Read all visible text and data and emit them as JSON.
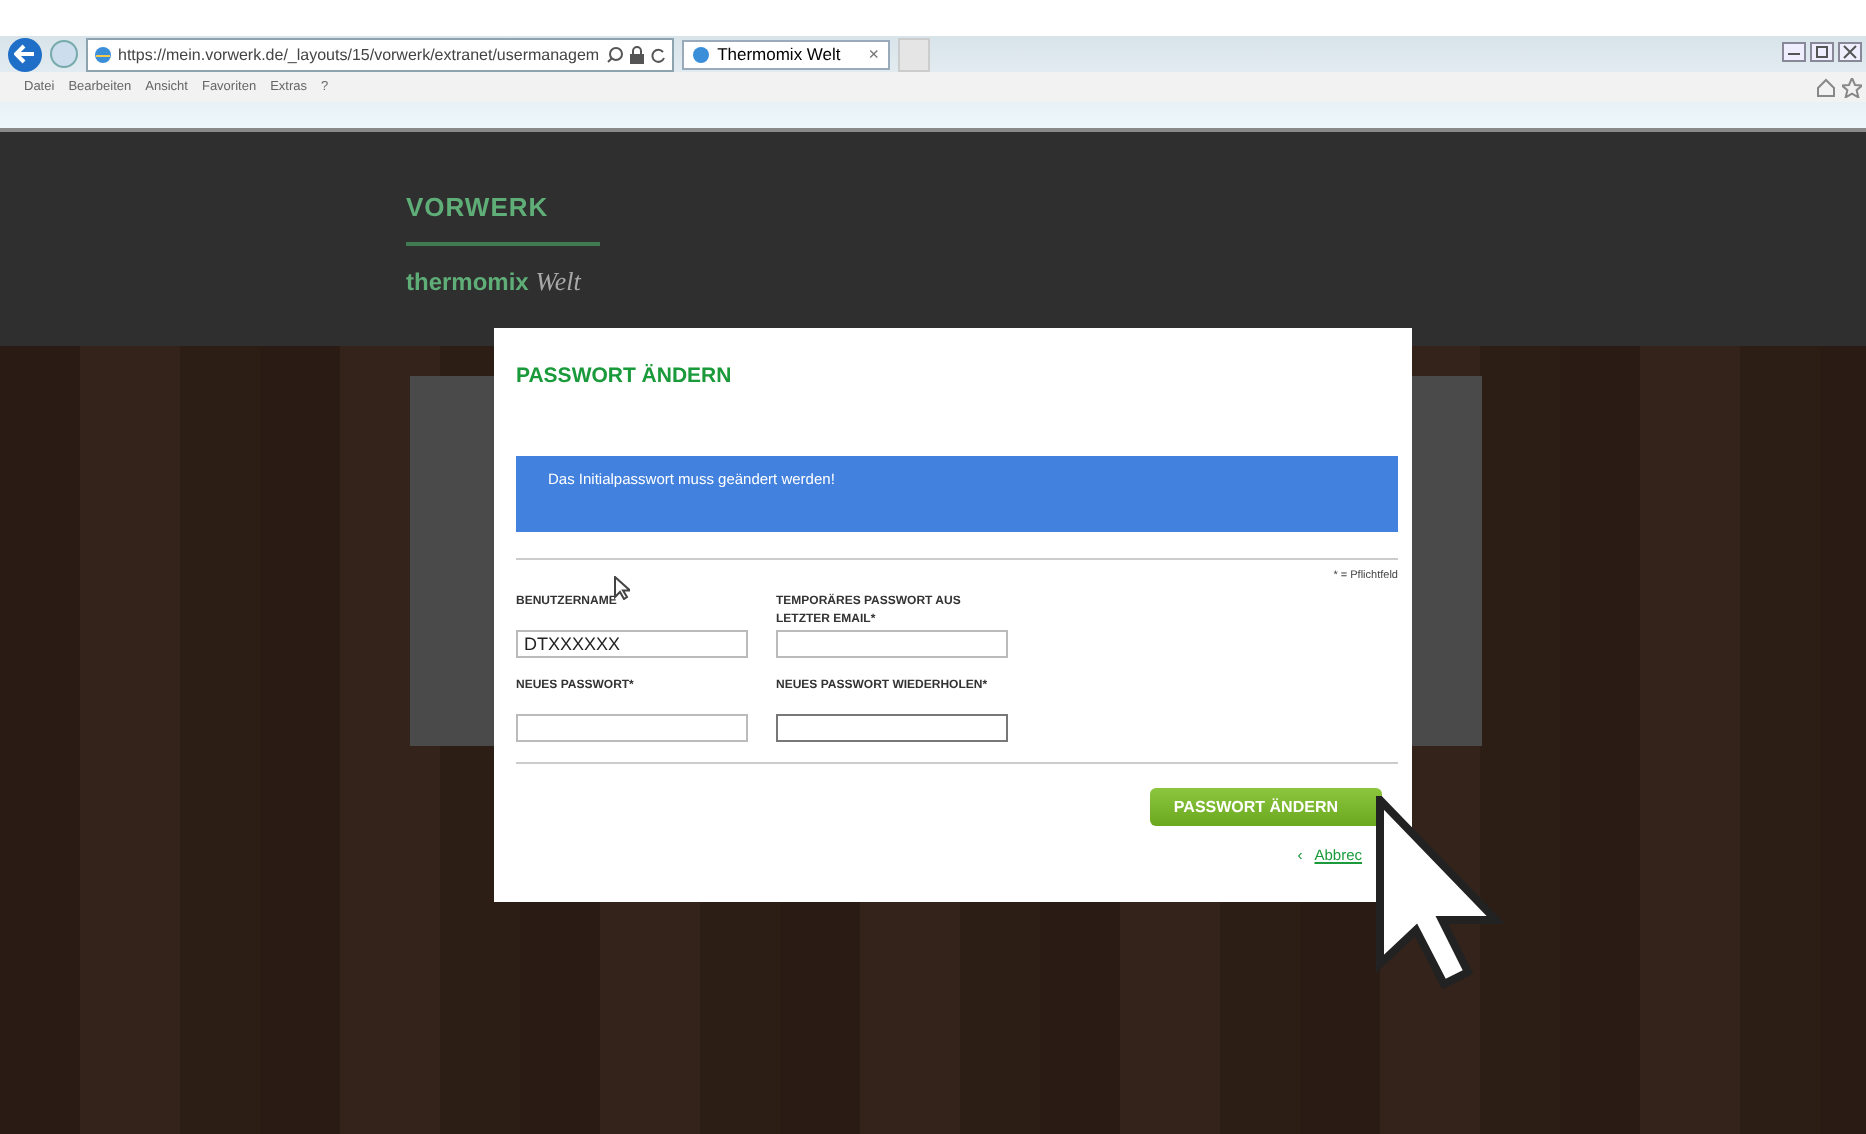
{
  "browser": {
    "url": "https://mein.vorwerk.de/_layouts/15/vorwerk/extranet/usermanagem",
    "tabs": [
      {
        "title": "Thermomix Welt",
        "close": "×",
        "selected": true
      }
    ],
    "menu": [
      "Datei",
      "Bearbeiten",
      "Ansicht",
      "Favoriten",
      "Extras",
      "?"
    ]
  },
  "site": {
    "brand": "VORWERK",
    "product": "thermomix",
    "product_suffix": "Welt"
  },
  "dialog": {
    "title": "PASSWORT ÄNDERN",
    "message": "Das Initialpasswort muss geändert werden!",
    "required_note": "* = Pflichtfeld",
    "fields": [
      {
        "label": "BENUTZERNAME",
        "value": "DTXXXXXX",
        "focused": false
      },
      {
        "label": "TEMPORÄRES PASSWORT AUS LETZTER EMAIL*",
        "focused": false
      },
      {
        "label": "NEUES PASSWORT*",
        "focused": false
      },
      {
        "label": "NEUES PASSWORT WIEDERHOLEN*",
        "focused": true
      }
    ],
    "submit": "PASSWORT ÄNDERN",
    "cancel_icon": "‹",
    "cancel": "Abbrec"
  }
}
